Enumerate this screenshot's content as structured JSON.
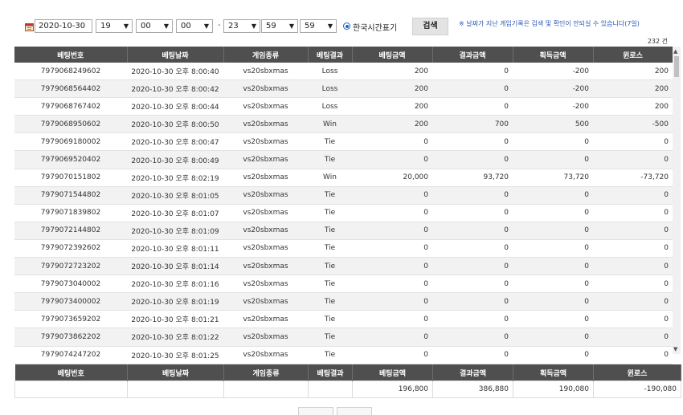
{
  "filter": {
    "date": "2020-10-30",
    "start_hour": "19",
    "start_min": "00",
    "start_sec": "00",
    "end_hour": "23",
    "end_min": "59",
    "end_sec": "59",
    "separator": "-",
    "timezone_label": "한국시간표기",
    "search_label": "검색",
    "notice": "※ 날짜가 지난 게임기록은 검색 및 확인이 안되실 수 있습니다(7일)",
    "total_count": "232 건"
  },
  "columns": [
    "베팅번호",
    "베팅날짜",
    "게임종류",
    "베팅결과",
    "베팅금액",
    "결과금액",
    "획득금액",
    "윈로스"
  ],
  "rows": [
    [
      "7979068249602",
      "2020-10-30 오후 8:00:40",
      "vs20sbxmas",
      "Loss",
      "200",
      "0",
      "-200",
      "200"
    ],
    [
      "7979068564402",
      "2020-10-30 오후 8:00:42",
      "vs20sbxmas",
      "Loss",
      "200",
      "0",
      "-200",
      "200"
    ],
    [
      "7979068767402",
      "2020-10-30 오후 8:00:44",
      "vs20sbxmas",
      "Loss",
      "200",
      "0",
      "-200",
      "200"
    ],
    [
      "7979068950602",
      "2020-10-30 오후 8:00:50",
      "vs20sbxmas",
      "Win",
      "200",
      "700",
      "500",
      "-500"
    ],
    [
      "7979069180002",
      "2020-10-30 오후 8:00:47",
      "vs20sbxmas",
      "Tie",
      "0",
      "0",
      "0",
      "0"
    ],
    [
      "7979069520402",
      "2020-10-30 오후 8:00:49",
      "vs20sbxmas",
      "Tie",
      "0",
      "0",
      "0",
      "0"
    ],
    [
      "7979070151802",
      "2020-10-30 오후 8:02:19",
      "vs20sbxmas",
      "Win",
      "20,000",
      "93,720",
      "73,720",
      "-73,720"
    ],
    [
      "7979071544802",
      "2020-10-30 오후 8:01:05",
      "vs20sbxmas",
      "Tie",
      "0",
      "0",
      "0",
      "0"
    ],
    [
      "7979071839802",
      "2020-10-30 오후 8:01:07",
      "vs20sbxmas",
      "Tie",
      "0",
      "0",
      "0",
      "0"
    ],
    [
      "7979072144802",
      "2020-10-30 오후 8:01:09",
      "vs20sbxmas",
      "Tie",
      "0",
      "0",
      "0",
      "0"
    ],
    [
      "7979072392602",
      "2020-10-30 오후 8:01:11",
      "vs20sbxmas",
      "Tie",
      "0",
      "0",
      "0",
      "0"
    ],
    [
      "7979072723202",
      "2020-10-30 오후 8:01:14",
      "vs20sbxmas",
      "Tie",
      "0",
      "0",
      "0",
      "0"
    ],
    [
      "7979073040002",
      "2020-10-30 오후 8:01:16",
      "vs20sbxmas",
      "Tie",
      "0",
      "0",
      "0",
      "0"
    ],
    [
      "7979073400002",
      "2020-10-30 오후 8:01:19",
      "vs20sbxmas",
      "Tie",
      "0",
      "0",
      "0",
      "0"
    ],
    [
      "7979073659202",
      "2020-10-30 오후 8:01:21",
      "vs20sbxmas",
      "Tie",
      "0",
      "0",
      "0",
      "0"
    ],
    [
      "7979073862202",
      "2020-10-30 오후 8:01:22",
      "vs20sbxmas",
      "Tie",
      "0",
      "0",
      "0",
      "0"
    ],
    [
      "7979074247202",
      "2020-10-30 오후 8:01:25",
      "vs20sbxmas",
      "Tie",
      "0",
      "0",
      "0",
      "0"
    ]
  ],
  "totals": [
    "",
    "",
    "",
    "",
    "196,800",
    "386,880",
    "190,080",
    "-190,080"
  ],
  "icons": {
    "calendar": "calendar-icon",
    "dropdown": "chevron-down-icon",
    "scroll_up": "scroll-up-icon",
    "scroll_down": "scroll-down-icon"
  },
  "colors": {
    "header_bg": "#4f4f4f",
    "notice": "#2c58b8",
    "radio": "#1a63c9"
  }
}
